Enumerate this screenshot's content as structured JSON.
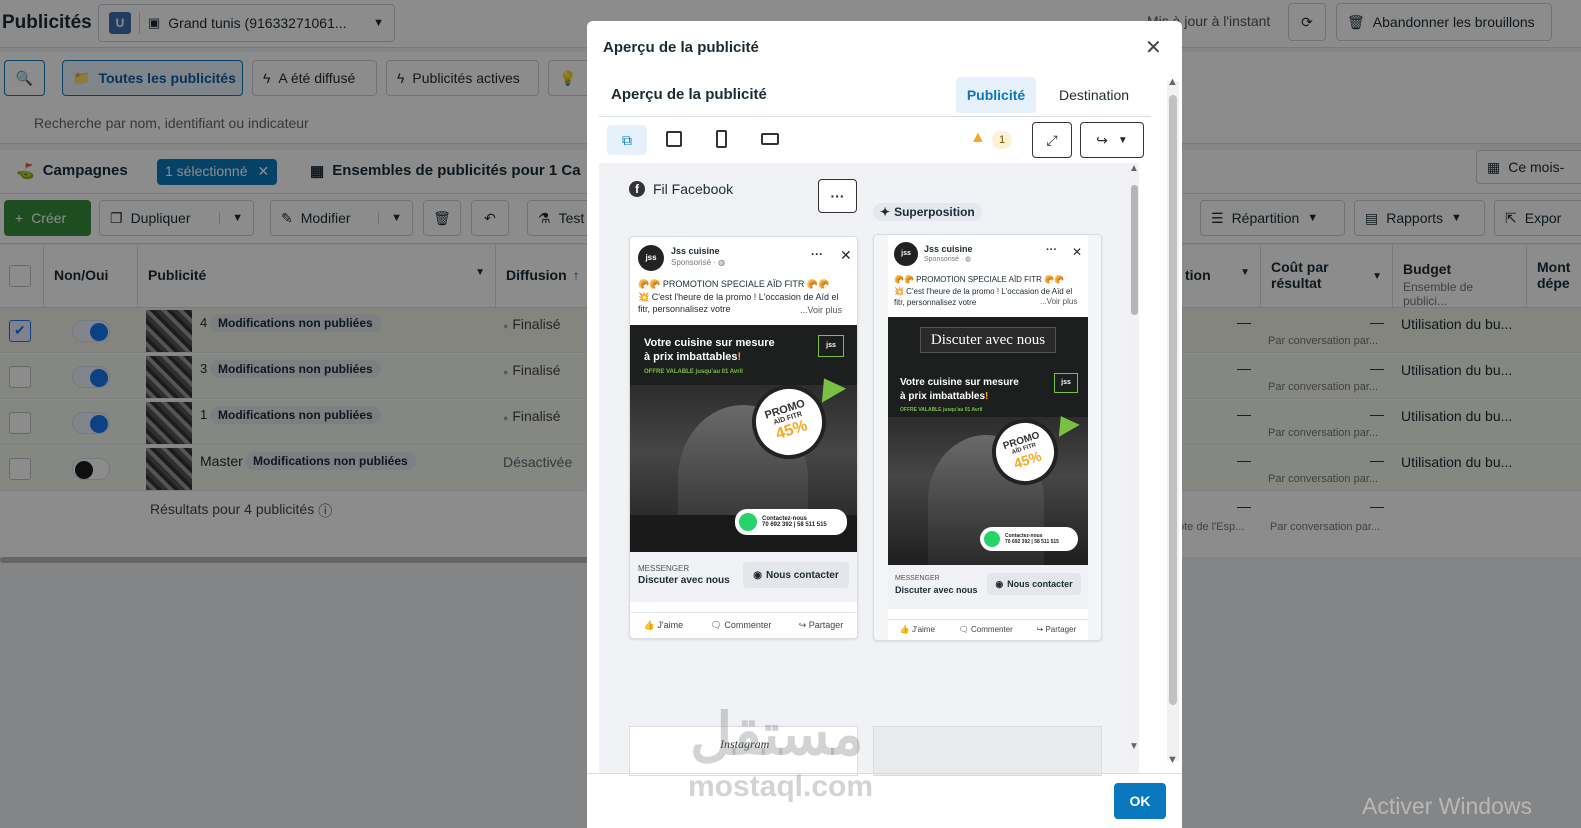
{
  "topbar": {
    "title": "Publicités",
    "account_initial": "U",
    "account_name": "Grand tunis (91633271061...",
    "updated": "Mis à jour à l'instant",
    "discard": "Abandonner les brouillons"
  },
  "filters": {
    "tabs": [
      "Toutes les publicités",
      "A été diffusé",
      "Publicités actives"
    ],
    "search_placeholder": "Recherche par nom, identifiant ou indicateur"
  },
  "levels": {
    "campaigns": "Campagnes",
    "selected": "1 sélectionné",
    "adsets": "Ensembles de publicités pour 1 Ca",
    "date": "Ce mois-"
  },
  "toolbar": {
    "create": "Créer",
    "duplicate": "Dupliquer",
    "edit": "Modifier",
    "test": "Test",
    "breakdown": "Répartition",
    "reports": "Rapports",
    "export": "Expor"
  },
  "table": {
    "headers": {
      "toggle": "Non/Oui",
      "ad": "Publicité",
      "delivery": "Diffusion",
      "attribution": "tion",
      "cost": "Coût par résultat",
      "budget": "Budget",
      "budget_sub": "Ensemble de publici...",
      "amount": "Mont",
      "amount2": "dépe"
    },
    "rows": [
      {
        "num": "4",
        "name": "Modifications non publiées",
        "delivery": "Finalisé",
        "dash": "—",
        "cost": "—",
        "cost_sub": "Par conversation par...",
        "budget": "Utilisation du bu..."
      },
      {
        "num": "3",
        "name": "Modifications non publiées",
        "delivery": "Finalisé",
        "dash": "—",
        "cost": "—",
        "cost_sub": "Par conversation par...",
        "budget": "Utilisation du bu..."
      },
      {
        "num": "1",
        "name": "Modifications non publiées",
        "delivery": "Finalisé",
        "dash": "—",
        "cost": "—",
        "cost_sub": "Par conversation par...",
        "budget": "Utilisation du bu..."
      },
      {
        "num": "Master",
        "name": "Modifications non publiées",
        "delivery": "Désactivée",
        "dash": "—",
        "cost": "—",
        "cost_sub": "Par conversation par...",
        "budget": "Utilisation du bu..."
      }
    ],
    "summary": "Résultats pour 4 publicités",
    "summary_dash": "—",
    "summary_attr": "ote de l'Esp...",
    "summary_cost_dash": "—",
    "summary_cost": "Par conversation par..."
  },
  "modal": {
    "title": "Aperçu de la publicité",
    "subtitle": "Aperçu de la publicité",
    "tab_ad": "Publicité",
    "tab_dest": "Destination",
    "warning_count": "1",
    "placement_label": "Fil Facebook",
    "overlay_label": "Superposition",
    "instagram": "Instagram",
    "ok": "OK"
  },
  "post": {
    "page": "Jss cuisine",
    "sponsored": "Sponsorisé · ",
    "line1": "🥐🥐 PROMOTION SPECIALE AÏD FITR 🥐🥐",
    "line2": "💥 C'est l'heure de la promo ! L'occasion de Aïd el fitr, personnalisez votre",
    "see_more": "...Voir plus",
    "headline1": "Votre cuisine sur mesure",
    "headline2": "à prix imbattables",
    "offer": "OFFRE VALABLE jusqu'au 01 Avril",
    "promo1": "PROMO",
    "promo2": "AÏD FITR",
    "promo3": "45%",
    "contact1": "Contactez-nous",
    "contact2": "70 692 392 | 58 511 515",
    "cta_label": "MESSENGER",
    "cta_text": "Discuter avec nous",
    "cta_btn": "Nous contacter",
    "like": "J'aime",
    "comment": "Commenter",
    "share": "Partager",
    "overlay_text": "Discuter avec nous",
    "logo": "jss"
  },
  "footer_text": "",
  "watermark": {
    "word": "مستقل",
    "site": "mostaql.com"
  },
  "windows": "Activer Windows",
  "colors": {
    "primary": "#0a78be",
    "green": "#3a8d3f",
    "warn": "#f5a623"
  }
}
